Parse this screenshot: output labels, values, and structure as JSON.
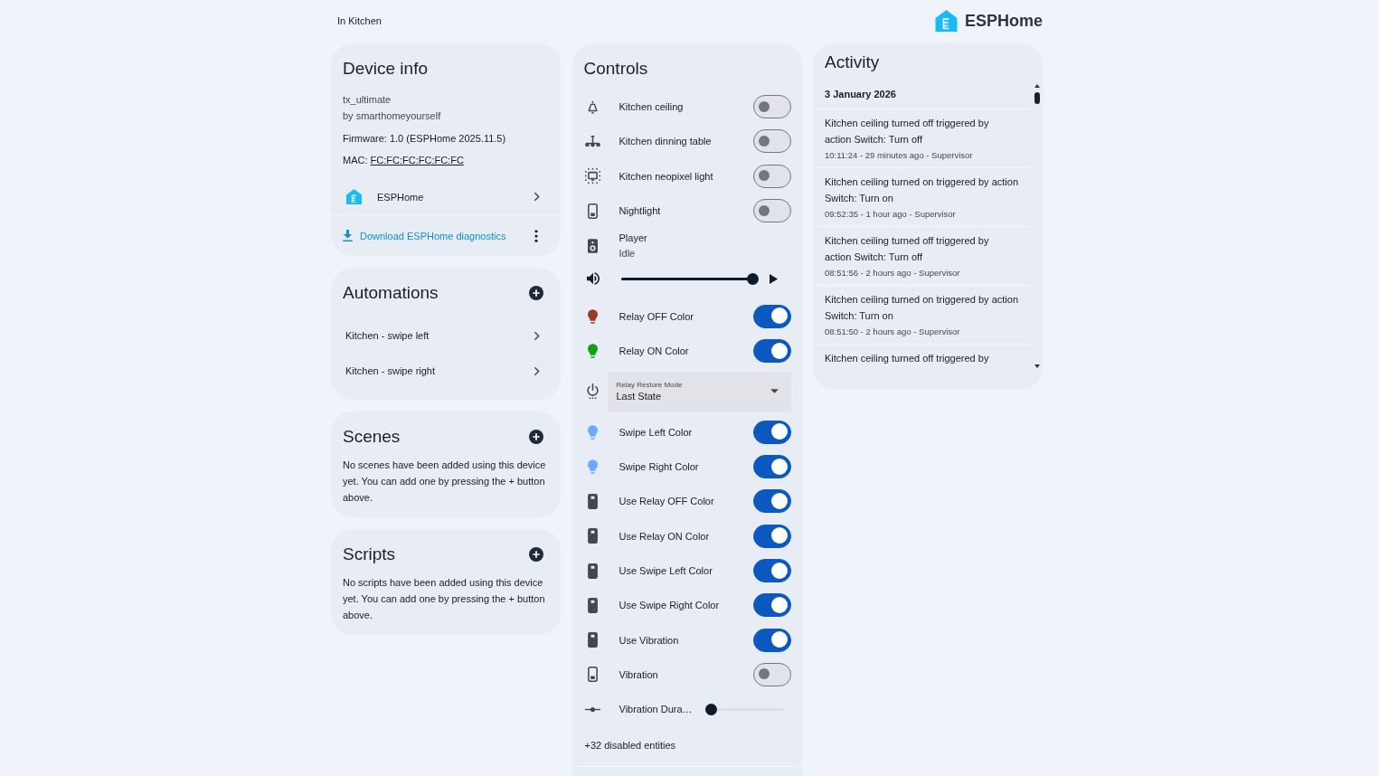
{
  "header": {
    "breadcrumb": "In Kitchen",
    "logo_text": "ESPHome"
  },
  "device_info": {
    "title": "Device info",
    "model": "tx_ultimate",
    "manufacturer": "by smarthomeyourself",
    "firmware": "Firmware: 1.0 (ESPHome 2025.11.5)",
    "mac": {
      "label": "MAC:",
      "value": "FC:FC:FC:FC:FC:FC"
    },
    "integration": "ESPHome",
    "download": "Download ESPHome diagnostics"
  },
  "automations": {
    "title": "Automations",
    "items": [
      "Kitchen - swipe left",
      "Kitchen - swipe right"
    ]
  },
  "scenes": {
    "title": "Scenes",
    "empty_text": "No scenes have been added using this device yet. You can add one by pressing the + button above."
  },
  "scripts": {
    "title": "Scripts",
    "empty_text": "No scripts have been added using this device yet. You can add one by pressing the + button above."
  },
  "controls": {
    "title": "Controls",
    "entities": [
      {
        "kind": "switch",
        "name": "Kitchen ceiling",
        "on": false
      },
      {
        "kind": "switch",
        "name": "Kitchen dinning table",
        "on": false
      },
      {
        "kind": "switch",
        "name": "Kitchen neopixel light",
        "on": false
      },
      {
        "kind": "switch",
        "name": "Nightlight",
        "on": false
      },
      {
        "kind": "media",
        "name": "Player",
        "state": "Idle",
        "level": 1
      },
      {
        "kind": "light",
        "name": "Relay OFF Color",
        "on": true,
        "color": "#9c3b2a"
      },
      {
        "kind": "light",
        "name": "Relay ON Color",
        "on": true,
        "color": "#14a014"
      },
      {
        "kind": "select",
        "label": "Relay Restore Mode",
        "value": "Last State"
      },
      {
        "kind": "light",
        "name": "Swipe Left Color",
        "on": true,
        "color": "#6fa8fc"
      },
      {
        "kind": "light",
        "name": "Swipe Right Color",
        "on": true,
        "color": "#6fa8fc"
      },
      {
        "kind": "switch",
        "name": "Use Relay OFF Color",
        "on": true
      },
      {
        "kind": "switch",
        "name": "Use Relay ON Color",
        "on": true
      },
      {
        "kind": "switch",
        "name": "Use Swipe Left Color",
        "on": true
      },
      {
        "kind": "switch",
        "name": "Use Swipe Right Color",
        "on": true
      },
      {
        "kind": "switch",
        "name": "Use Vibration",
        "on": true
      },
      {
        "kind": "switch",
        "name": "Vibration",
        "on": false
      },
      {
        "kind": "number",
        "name": "Vibration Dura…",
        "level": 0
      }
    ],
    "disabled_note": "+32 disabled entities"
  },
  "activity": {
    "title": "Activity",
    "date": "3 January 2026",
    "entries": [
      {
        "message": "Kitchen ceiling turned off triggered by\naction Switch: Turn off",
        "meta": "10:11:24 - 29 minutes ago - Supervisor"
      },
      {
        "message": "Kitchen ceiling turned on triggered by action\nSwitch: Turn on",
        "meta": "09:52:35 - 1 hour ago - Supervisor"
      },
      {
        "message": "Kitchen ceiling turned off triggered by\naction Switch: Turn off",
        "meta": "08:51:56 - 2 hours ago - Supervisor"
      },
      {
        "message": "Kitchen ceiling turned on triggered by action\nSwitch: Turn on",
        "meta": "08:51:50 - 2 hours ago - Supervisor"
      },
      {
        "message": "Kitchen ceiling turned off triggered by"
      }
    ]
  }
}
